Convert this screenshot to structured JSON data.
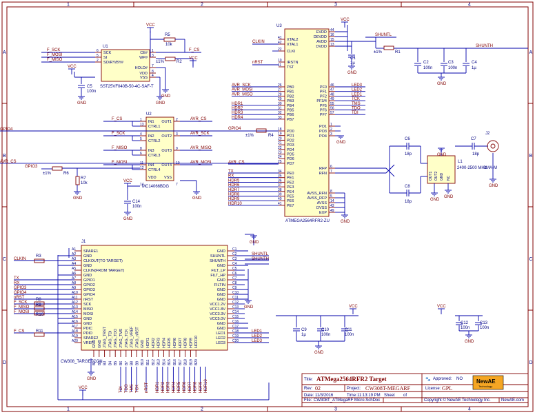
{
  "frame": {
    "columns": [
      "1",
      "2",
      "3",
      "4"
    ],
    "rows": [
      "A",
      "B",
      "C",
      "D"
    ]
  },
  "title_block": {
    "title_label": "Title:",
    "title": "ATMega2564RFR2 Target",
    "approved_label": "Approved:",
    "approved": "NO",
    "rev_label": "Rev:",
    "rev": "02",
    "project_label": "Project:",
    "project": "CW308T-MEGARF",
    "license_label": "License:",
    "license": "GPL",
    "date_label": "Date:",
    "date": "11/3/2016",
    "time_label": "Time:",
    "time": "11:13:19 PM",
    "sheet_label": "Sheet",
    "sheet_of": "of",
    "file_label": "File:",
    "file": "CW308T_ATMegaRF Micro.SchDoc",
    "copyright": "Copyright © NewAE Technology Inc.",
    "website": "NewAE.com",
    "logo_text": "NewAE",
    "logo_sub": "Technology"
  },
  "u1": {
    "ref": "U1",
    "part": "SST25VF040B-50-4C-SAF-T",
    "left_pins": [
      {
        "num": "6",
        "name": "SCK"
      },
      {
        "num": "5",
        "name": "SI"
      },
      {
        "num": "2",
        "name": "SO/RY/BY#"
      }
    ],
    "right_pins": [
      {
        "num": "1",
        "name": "CE#"
      },
      {
        "num": "3",
        "name": "WP#"
      },
      {
        "num": "7",
        "name": "HOLD#"
      },
      {
        "num": "8",
        "name": "VDD"
      },
      {
        "num": "4",
        "name": "VSS"
      }
    ],
    "nets": [
      "F_SCK",
      "F_MOSI",
      "F_MISO",
      "F_CS"
    ],
    "r5": "R5",
    "r5_val": "10k",
    "r2": "R2",
    "r2_tol": "±1%"
  },
  "u2": {
    "ref": "U2",
    "part": "MC14066BDG",
    "left": [
      {
        "nums": [
          "1",
          "13"
        ],
        "names": [
          "IN1",
          "CTRL1"
        ],
        "net": "F_CS"
      },
      {
        "nums": [
          "4",
          "5"
        ],
        "names": [
          "IN2",
          "CTRL2"
        ],
        "net": "F_SCK"
      },
      {
        "nums": [
          "8",
          "6"
        ],
        "names": [
          "IN3",
          "CTRL3"
        ],
        "net": "F_MISO"
      },
      {
        "nums": [
          "11",
          "12"
        ],
        "names": [
          "IN4",
          "CTRL4"
        ],
        "net": "F_MOSI"
      }
    ],
    "right": [
      {
        "num": "2",
        "name": "OUT1",
        "net": "AVR_CS"
      },
      {
        "num": "3",
        "name": "OUT2",
        "net": "AVR_SCK"
      },
      {
        "num": "9",
        "name": "OUT3",
        "net": "AVR_MISO"
      },
      {
        "num": "10",
        "name": "OUT4",
        "net": "AVR_MOSI"
      }
    ],
    "power": [
      {
        "num": "14",
        "name": "VDD"
      },
      {
        "num": "7",
        "name": "VSS"
      }
    ],
    "gpio3": "GPIO3",
    "r6": "R6",
    "r6_tol": "±1%",
    "r7": "R7",
    "r7_val": "10k",
    "c14": "C14",
    "c14_val": "100n"
  },
  "u3": {
    "ref": "U3",
    "part": "ATMEGA2564RFR2-ZU",
    "top_left": [
      {
        "num": "41",
        "name": "XTAL2"
      },
      {
        "num": "42",
        "name": "XTAL1"
      },
      {
        "num": "22",
        "name": "CLKI"
      },
      {
        "num": "10",
        "name": "/RSTN"
      },
      {
        "num": "11",
        "name": "TST"
      }
    ],
    "top_right": [
      {
        "num": "44",
        "name": "EVDD"
      },
      {
        "num": "16",
        "name": "DEVDD"
      },
      {
        "num": "15",
        "name": "AVDD"
      },
      {
        "num": "13",
        "name": "DVDD"
      }
    ],
    "pb": [
      {
        "num": "26",
        "name": "PB0",
        "net": "AVR_SCK"
      },
      {
        "num": "27",
        "name": "PB1",
        "net": "AVR_MOSI"
      },
      {
        "num": "28",
        "name": "PB2",
        "net": "AVR_MISO"
      },
      {
        "num": "29",
        "name": "PB3",
        "net": ""
      },
      {
        "num": "30",
        "name": "PB4",
        "net": "HDR1"
      },
      {
        "num": "31",
        "name": "PB5",
        "net": "HDR2"
      },
      {
        "num": "32",
        "name": "PB6",
        "net": "HDR3"
      },
      {
        "num": "33",
        "name": "PB7",
        "net": "HDR4"
      }
    ],
    "pf": [
      {
        "num": "46",
        "name": "PF0",
        "net": "LED3"
      },
      {
        "num": "47",
        "name": "PF1",
        "net": "LED2"
      },
      {
        "num": "48",
        "name": "PF2",
        "net": "LED1"
      },
      {
        "num": "49",
        "name": "PF3/4",
        "net": "TCK"
      },
      {
        "num": "55",
        "name": "PF5",
        "net": "TMS"
      },
      {
        "num": "56",
        "name": "PF6",
        "net": "TDO"
      },
      {
        "num": "57",
        "name": "PF7",
        "net": "TDI"
      }
    ],
    "pd": [
      {
        "num": "18",
        "name": "PD0",
        "net": "GPIO4"
      },
      {
        "num": "19",
        "name": "PD1"
      },
      {
        "num": "20",
        "name": "PD2"
      },
      {
        "num": "21",
        "name": "PD3"
      },
      {
        "num": "22",
        "name": "PD4"
      },
      {
        "num": "23",
        "name": "PD5"
      },
      {
        "num": "24",
        "name": "PD6"
      },
      {
        "num": "25",
        "name": "PD7",
        "net": "AVR_CS"
      }
    ],
    "pg": [
      {
        "num": "1",
        "name": "PO1"
      },
      {
        "num": "2",
        "name": "PO3"
      },
      {
        "num": "3",
        "name": "PO4"
      }
    ],
    "pe": [
      {
        "num": "34",
        "name": "PE0",
        "net": "TX"
      },
      {
        "num": "35",
        "name": "PE1",
        "net": "RX"
      },
      {
        "num": "36",
        "name": "PE2",
        "net": "HDR5"
      },
      {
        "num": "37",
        "name": "PE3",
        "net": "HDR6"
      },
      {
        "num": "38",
        "name": "PE4",
        "net": "HDR7"
      },
      {
        "num": "39",
        "name": "PE5",
        "net": "HDR8"
      },
      {
        "num": "40",
        "name": "PE6",
        "net": "HDR9"
      },
      {
        "num": "41",
        "name": "PE7",
        "net": "HDR10"
      }
    ],
    "rf": [
      {
        "num": "6",
        "name": "RFP"
      },
      {
        "num": "7",
        "name": "RFN"
      }
    ],
    "gnd_pins": [
      {
        "num": "8",
        "name": "AVSS_RFN"
      },
      {
        "num": "5",
        "name": "AVSS_RFP"
      },
      {
        "num": "14",
        "name": "AVSS"
      },
      {
        "num": "43",
        "name": "DVSS"
      },
      {
        "num": "49",
        "name": "EXP"
      }
    ],
    "clkin": "CLKIN",
    "nrst": "nRST",
    "gpio4": "GPIO4",
    "r4": "R4",
    "r4_tol": "±1%",
    "shuntl": "SHUNTL",
    "shunth": "SHUNTH",
    "r1": "R1",
    "r1_tol": "±1%",
    "c1": "C1",
    "c1_val": "1µ",
    "c2": "C2",
    "c2_val": "100n",
    "c3": "C3",
    "c3_val": "100n",
    "c4": "C4",
    "c4_val": "1µ"
  },
  "rf": {
    "c6": "C6",
    "c6_val": "18p",
    "c8": "C8",
    "c8_val": "18p",
    "c7": "C7",
    "c7_val": "18p",
    "l1": "L1",
    "l1_note": "2400-2500 MHz",
    "j2": "J2",
    "j2_part": "SMA-M",
    "balun_pins": [
      "OUT1",
      "OUT2",
      "GND",
      "NC",
      "IN"
    ]
  },
  "j1": {
    "ref": "J1",
    "part": "CW308_TARGETCON",
    "a_pins": [
      {
        "num": "A1",
        "name": "SPARE1",
        "net": ""
      },
      {
        "num": "A2",
        "name": "GND",
        "net": ""
      },
      {
        "num": "A3",
        "name": "CLKOUT(TO TARGET)",
        "net": "CLKIN"
      },
      {
        "num": "A4",
        "name": "GND",
        "net": ""
      },
      {
        "num": "A5",
        "name": "CLKIN(FROM TARGET)",
        "net": ""
      },
      {
        "num": "A6",
        "name": "GND",
        "net": ""
      },
      {
        "num": "A7",
        "name": "GPIO1",
        "net": "TX"
      },
      {
        "num": "A8",
        "name": "GPIO2",
        "net": "RX"
      },
      {
        "num": "A9",
        "name": "GPIO3",
        "net": "GPIO3"
      },
      {
        "num": "A10",
        "name": "GPIO4",
        "net": "GPIO4"
      },
      {
        "num": "A11",
        "name": "nRST",
        "net": "nRST"
      },
      {
        "num": "A12",
        "name": "SCK",
        "net": "F_SCK"
      },
      {
        "num": "A13",
        "name": "MISO",
        "net": "F_MISO"
      },
      {
        "num": "A14",
        "name": "MOSI",
        "net": "F_MOSI"
      },
      {
        "num": "A15",
        "name": "GND",
        "net": ""
      },
      {
        "num": "A16",
        "name": "GND",
        "net": ""
      },
      {
        "num": "A17",
        "name": "PDIC",
        "net": ""
      },
      {
        "num": "A18",
        "name": "PDID",
        "net": "F_CS"
      },
      {
        "num": "A19",
        "name": "SPARE2",
        "net": ""
      },
      {
        "num": "A20",
        "name": "VREF",
        "net": ""
      }
    ],
    "c_pins": [
      {
        "num": "C1",
        "name": "GND",
        "net": ""
      },
      {
        "num": "C2",
        "name": "SHUNTL",
        "net": "SHUNTL"
      },
      {
        "num": "C3",
        "name": "SHUNTH",
        "net": "SHUNTH"
      },
      {
        "num": "C4",
        "name": "GND",
        "net": ""
      },
      {
        "num": "C5",
        "name": "FILT_LP",
        "net": ""
      },
      {
        "num": "C6",
        "name": "FILT_HP",
        "net": ""
      },
      {
        "num": "C7",
        "name": "GND",
        "net": ""
      },
      {
        "num": "C8",
        "name": "FILTIN",
        "net": ""
      },
      {
        "num": "C9",
        "name": "GND",
        "net": ""
      },
      {
        "num": "C10",
        "name": "GND",
        "net": ""
      },
      {
        "num": "C11",
        "name": "GND",
        "net": ""
      },
      {
        "num": "C12",
        "name": "VCC1.2V",
        "net": ""
      },
      {
        "num": "C13",
        "name": "VCC1.8V",
        "net": ""
      },
      {
        "num": "C14",
        "name": "VCC3.3V",
        "net": ""
      },
      {
        "num": "C15",
        "name": "VCC5.0V",
        "net": ""
      },
      {
        "num": "C16",
        "name": "GND",
        "net": ""
      },
      {
        "num": "C17",
        "name": "GND",
        "net": ""
      },
      {
        "num": "C18",
        "name": "LED1",
        "net": "LED1"
      },
      {
        "num": "C19",
        "name": "LED2",
        "net": "LED2"
      },
      {
        "num": "C20",
        "name": "LED3",
        "net": "LED3"
      }
    ],
    "b_pins": [
      "GND",
      "GND",
      "JTAG_TRST",
      "JTAG_TDI",
      "JTAG_TDO",
      "JTAG_TMS",
      "JTAG_TCK",
      "JTAG_VREF",
      "JTAG_nRST",
      "GND",
      "HDR1",
      "HDR2",
      "HDR3",
      "HDR4",
      "HDR5",
      "HDR6",
      "HDR7",
      "HDR8",
      "HDR9",
      "HDR10"
    ],
    "b_nums": [
      "B1",
      "B2",
      "B3",
      "B4",
      "B5",
      "B6",
      "B7",
      "B8",
      "B9",
      "B10",
      "B11",
      "B12",
      "B13",
      "B14",
      "B15",
      "B16",
      "B17",
      "B18",
      "B19",
      "B20"
    ],
    "bottom_nets": [
      "TDI",
      "TDO",
      "TMS",
      "TCK",
      "nRST",
      "HDR1",
      "HDR2",
      "HDR3",
      "HDR4",
      "HDR5",
      "HDR6",
      "HDR7",
      "HDR8",
      "HDR9",
      "HDR10"
    ],
    "r_labels": {
      "r3": "R3",
      "r8": "R8",
      "r9": "R9",
      "r10": "R10",
      "r11": "R11"
    },
    "caps": [
      {
        "ref": "C9",
        "val": "1µ"
      },
      {
        "ref": "C10",
        "val": "100n"
      },
      {
        "ref": "C11",
        "val": "100n"
      },
      {
        "ref": "C12",
        "val": "100n"
      },
      {
        "ref": "C13",
        "val": "100n"
      }
    ]
  },
  "power": {
    "vcc": "VCC",
    "gnd": "GND"
  }
}
